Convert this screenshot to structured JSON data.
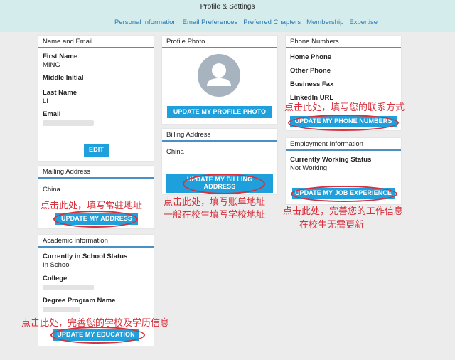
{
  "header": {
    "title": "Profile & Settings",
    "nav": [
      "Personal Information",
      "Email Preferences",
      "Preferred Chapters",
      "Membership",
      "Expertise"
    ]
  },
  "name_email": {
    "title": "Name and Email",
    "first_name_label": "First Name",
    "first_name": "MING",
    "middle_label": "Middle Initial",
    "last_name_label": "Last Name",
    "last_name": "LI",
    "email_label": "Email",
    "edit_button": "EDIT"
  },
  "mailing": {
    "title": "Mailing Address",
    "value": "China",
    "button": "UPDATE MY ADDRESS",
    "note": "点击此处，填写常驻地址"
  },
  "academic": {
    "title": "Academic Information",
    "status_label": "Currently in School Status",
    "status": "In School",
    "college_label": "College",
    "degree_label": "Degree Program Name",
    "button": "UPDATE MY EDUCATION",
    "note": "点击此处，完善您的学校及学历信息"
  },
  "photo": {
    "title": "Profile Photo",
    "button": "UPDATE MY PROFILE PHOTO"
  },
  "billing": {
    "title": "Billing Address",
    "value": "China",
    "button_line1": "UPDATE MY BILLING",
    "button_line2": "ADDRESS",
    "note_line1": "点击此处，填写账单地址",
    "note_line2": "一般在校生填写学校地址"
  },
  "phone": {
    "title": "Phone Numbers",
    "home": "Home Phone",
    "other": "Other Phone",
    "fax": "Business Fax",
    "linkedin": "LinkedIn URL",
    "button": "UPDATE MY PHONE NUMBERS",
    "note": "点击此处，填写您的联系方式"
  },
  "employment": {
    "title": "Employment Information",
    "status_label": "Currently Working Status",
    "status": "Not Working",
    "button": "UPDATE MY JOB EXPERIENCE",
    "note_line1": "点击此处，完善您的工作信息",
    "note_line2": "在校生无需更新"
  },
  "colors": {
    "accent": "#1ea0dc",
    "annotation": "#d8303c",
    "header_bg": "#d4ecec",
    "link": "#2a7bb5"
  },
  "icons": {
    "avatar": "person-silhouette-icon"
  }
}
